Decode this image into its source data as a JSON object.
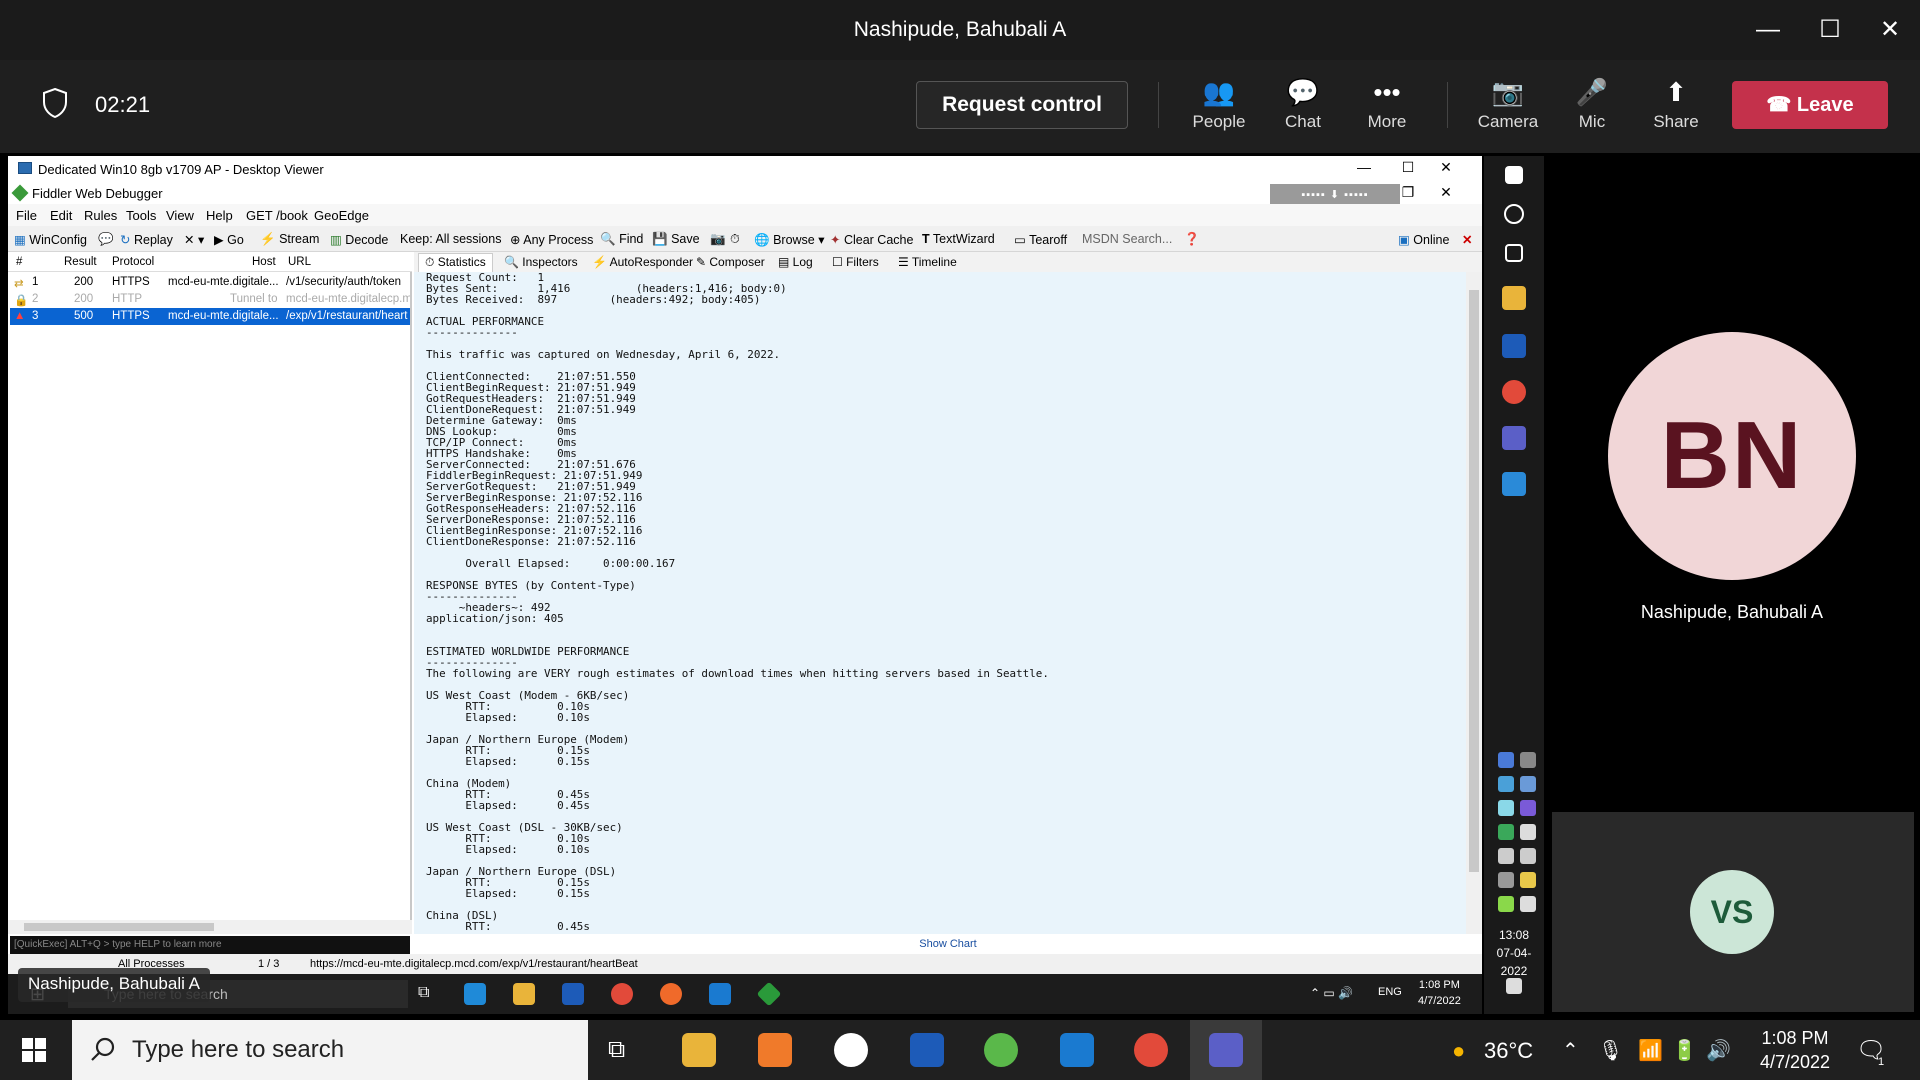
{
  "teams": {
    "window_title": "Nashipude, Bahubali A",
    "timer": "02:21",
    "request_control": "Request control",
    "buttons": {
      "people": "People",
      "chat": "Chat",
      "more": "More",
      "camera": "Camera",
      "mic": "Mic",
      "share": "Share",
      "leave": "Leave"
    }
  },
  "remote": {
    "window_title": "Dedicated Win10 8gb v1709 AP - Desktop Viewer",
    "app_title": "Fiddler Web Debugger",
    "menu": [
      "File",
      "Edit",
      "Rules",
      "Tools",
      "View",
      "Help",
      "GET /book",
      "GeoEdge"
    ],
    "toolbar": {
      "winconfig": "WinConfig",
      "replay": "Replay",
      "go": "Go",
      "stream": "Stream",
      "decode": "Decode",
      "keep": "Keep: All sessions",
      "any_process": "Any Process",
      "find": "Find",
      "save": "Save",
      "browse": "Browse",
      "clear_cache": "Clear Cache",
      "textwizard": "TextWizard",
      "tearoff": "Tearoff",
      "msdn": "MSDN Search...",
      "online": "Online"
    },
    "session_headers": [
      "#",
      "Result",
      "Protocol",
      "Host",
      "URL"
    ],
    "sessions": [
      {
        "num": "1",
        "result": "200",
        "protocol": "HTTPS",
        "host": "mcd-eu-mte.digitale...",
        "url": "/v1/security/auth/token"
      },
      {
        "num": "2",
        "result": "200",
        "protocol": "HTTP",
        "host": "Tunnel to",
        "url": "mcd-eu-mte.digitalecp.mc"
      },
      {
        "num": "3",
        "result": "500",
        "protocol": "HTTPS",
        "host": "mcd-eu-mte.digitale...",
        "url": "/exp/v1/restaurant/heart"
      }
    ],
    "quickexec": "[QuickExec] ALT+Q > type HELP to learn more",
    "tabs": [
      "Statistics",
      "Inspectors",
      "AutoResponder",
      "Composer",
      "Log",
      "Filters",
      "Timeline"
    ],
    "stats_text": "Request Count:   1\nBytes Sent:      1,416          (headers:1,416; body:0)\nBytes Received:  897        (headers:492; body:405)\n\nACTUAL PERFORMANCE\n--------------\n\nThis traffic was captured on Wednesday, April 6, 2022.\n\nClientConnected:    21:07:51.550\nClientBeginRequest: 21:07:51.949\nGotRequestHeaders:  21:07:51.949\nClientDoneRequest:  21:07:51.949\nDetermine Gateway:  0ms\nDNS Lookup:         0ms\nTCP/IP Connect:     0ms\nHTTPS Handshake:    0ms\nServerConnected:    21:07:51.676\nFiddlerBeginRequest: 21:07:51.949\nServerGotRequest:   21:07:51.949\nServerBeginResponse: 21:07:52.116\nGotResponseHeaders: 21:07:52.116\nServerDoneResponse: 21:07:52.116\nClientBeginResponse: 21:07:52.116\nClientDoneResponse: 21:07:52.116\n\n      Overall Elapsed:     0:00:00.167\n\nRESPONSE BYTES (by Content-Type)\n--------------\n     ~headers~: 492\napplication/json: 405\n\n\nESTIMATED WORLDWIDE PERFORMANCE\n--------------\nThe following are VERY rough estimates of download times when hitting servers based in Seattle.\n\nUS West Coast (Modem - 6KB/sec)\n      RTT:          0.10s\n      Elapsed:      0.10s\n\nJapan / Northern Europe (Modem)\n      RTT:          0.15s\n      Elapsed:      0.15s\n\nChina (Modem)\n      RTT:          0.45s\n      Elapsed:      0.45s\n\nUS West Coast (DSL - 30KB/sec)\n      RTT:          0.10s\n      Elapsed:      0.10s\n\nJapan / Northern Europe (DSL)\n      RTT:          0.15s\n      Elapsed:      0.15s\n\nChina (DSL)\n      RTT:          0.45s",
    "show_chart": "Show Chart",
    "status": {
      "processes": "All Processes",
      "count": "1 / 3",
      "url": "https://mcd-eu-mte.digitalecp.mcd.com/exp/v1/restaurant/heartBeat"
    },
    "taskbar": {
      "search": "Type here to search",
      "lang": "ENG",
      "time": "1:08 PM",
      "date": "4/7/2022"
    },
    "side_clock": {
      "time": "13:08",
      "date": "07-04-2022"
    }
  },
  "participants": {
    "presenter_name_tag": "Nashipude, Bahubali A",
    "bn_initials": "BN",
    "bn_name": "Nashipude, Bahubali A",
    "vs_initials": "VS"
  },
  "taskbar": {
    "search_placeholder": "Type here to search",
    "temperature": "36°C",
    "time": "1:08 PM",
    "date": "4/7/2022",
    "notification_count": "1"
  }
}
